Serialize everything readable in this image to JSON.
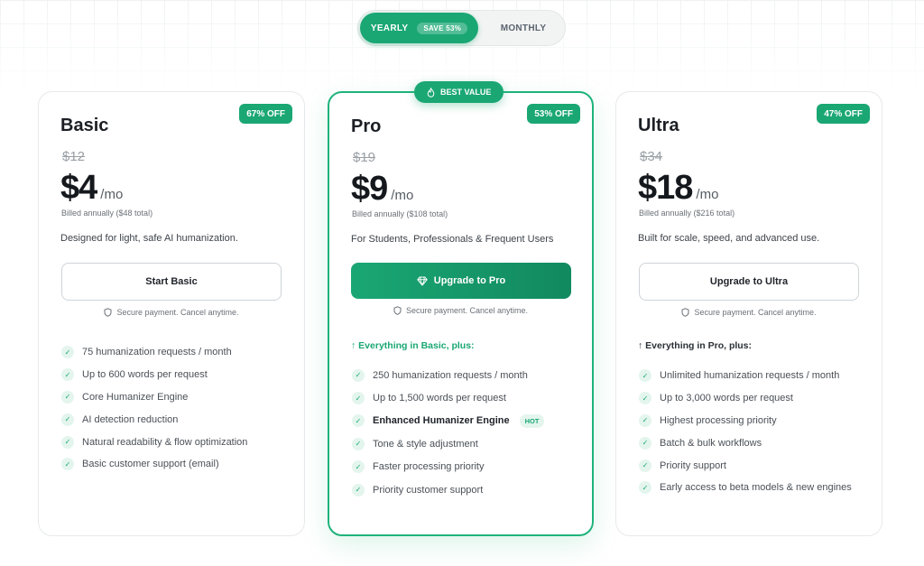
{
  "toggle": {
    "yearly": "YEARLY",
    "save": "SAVE 53%",
    "monthly": "MONTHLY"
  },
  "colors": {
    "accent": "#1aa774"
  },
  "plans": [
    {
      "name": "Basic",
      "discount": "67% OFF",
      "old_price": "$12",
      "price": "$4",
      "per": "/mo",
      "billed": "Billed annually ($48 total)",
      "description": "Designed for light, safe AI humanization.",
      "button": "Start Basic",
      "secure": "Secure payment. Cancel anytime.",
      "features": [
        "75 humanization requests / month",
        "Up to 600 words per request",
        "Core Humanizer Engine",
        "AI detection reduction",
        "Natural readability & flow optimization",
        "Basic customer support (email)"
      ]
    },
    {
      "name": "Pro",
      "badge": "BEST VALUE",
      "discount": "53% OFF",
      "old_price": "$19",
      "price": "$9",
      "per": "/mo",
      "billed": "Billed annually ($108 total)",
      "description": "For Students, Professionals & Frequent Users",
      "button": "Upgrade to Pro",
      "secure": "Secure payment. Cancel anytime.",
      "everything": "Everything in Basic, plus:",
      "features": [
        "250 humanization requests / month",
        "Up to 1,500 words per request",
        "Enhanced Humanizer Engine",
        "Tone & style adjustment",
        "Faster processing priority",
        "Priority customer support"
      ],
      "hot": "HOT"
    },
    {
      "name": "Ultra",
      "discount": "47% OFF",
      "old_price": "$34",
      "price": "$18",
      "per": "/mo",
      "billed": "Billed annually ($216 total)",
      "description": "Built for scale, speed, and advanced use.",
      "button": "Upgrade to Ultra",
      "secure": "Secure payment. Cancel anytime.",
      "everything": "Everything in Pro, plus:",
      "features": [
        "Unlimited humanization requests / month",
        "Up to 3,000 words per request",
        "Highest processing priority",
        "Batch & bulk workflows",
        "Priority support",
        "Early access to beta models & new engines"
      ]
    }
  ]
}
